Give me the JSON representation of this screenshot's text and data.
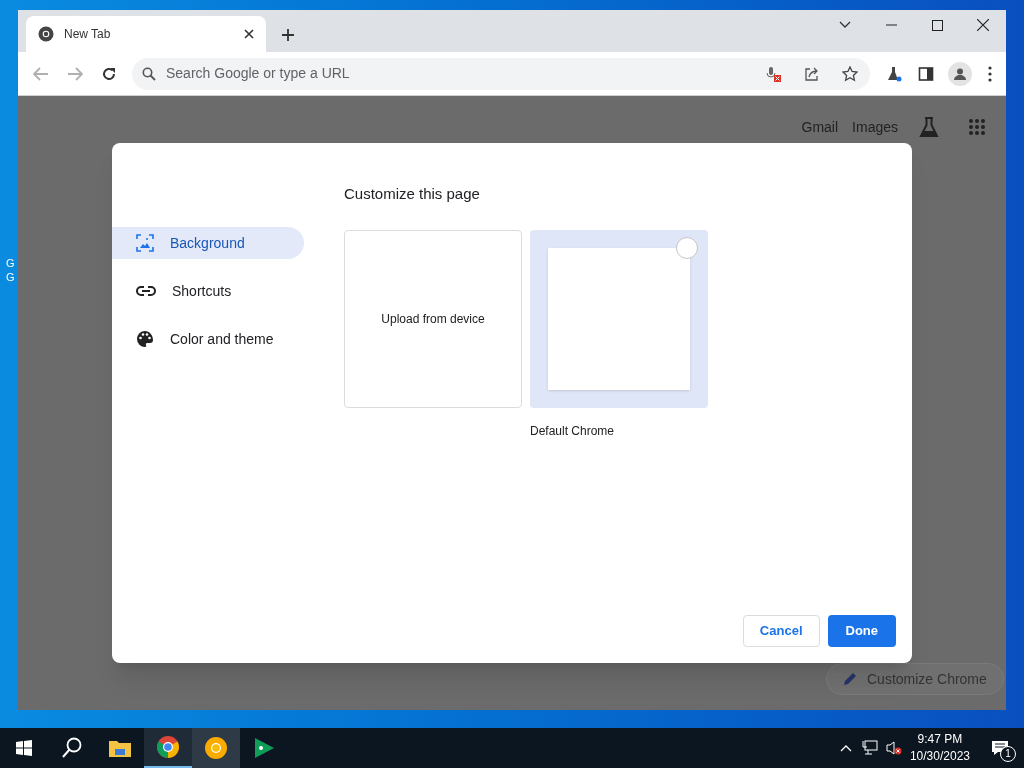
{
  "desktop": {
    "icon_labels": [
      "G",
      "G"
    ]
  },
  "browser": {
    "tabs": [
      {
        "title": "New Tab",
        "selected": true
      }
    ],
    "omnibox": {
      "placeholder": "Search Google or type a URL"
    }
  },
  "page": {
    "header_links": [
      "Gmail",
      "Images"
    ],
    "customize_button": "Customize Chrome"
  },
  "dialog": {
    "title": "Customize this page",
    "menu": [
      {
        "label": "Background",
        "kind": "image",
        "selected": true
      },
      {
        "label": "Shortcuts",
        "kind": "link",
        "selected": false
      },
      {
        "label": "Color and theme",
        "kind": "palette",
        "selected": false
      }
    ],
    "tiles": [
      {
        "kind": "upload",
        "label": "Upload from device",
        "selected": false
      },
      {
        "kind": "theme",
        "label": "Default Chrome",
        "selected": true
      }
    ],
    "buttons": [
      {
        "label": "Cancel",
        "kind": "secondary"
      },
      {
        "label": "Done",
        "kind": "primary"
      }
    ]
  },
  "taskbar": {
    "apps": [
      {
        "kind": "explorer",
        "selected": false
      },
      {
        "kind": "chrome",
        "selected": true
      },
      {
        "kind": "canary",
        "selected": false
      },
      {
        "kind": "games",
        "selected": false
      }
    ],
    "time": "9:47 PM",
    "date": "10/30/2023",
    "notification_count": "1"
  }
}
